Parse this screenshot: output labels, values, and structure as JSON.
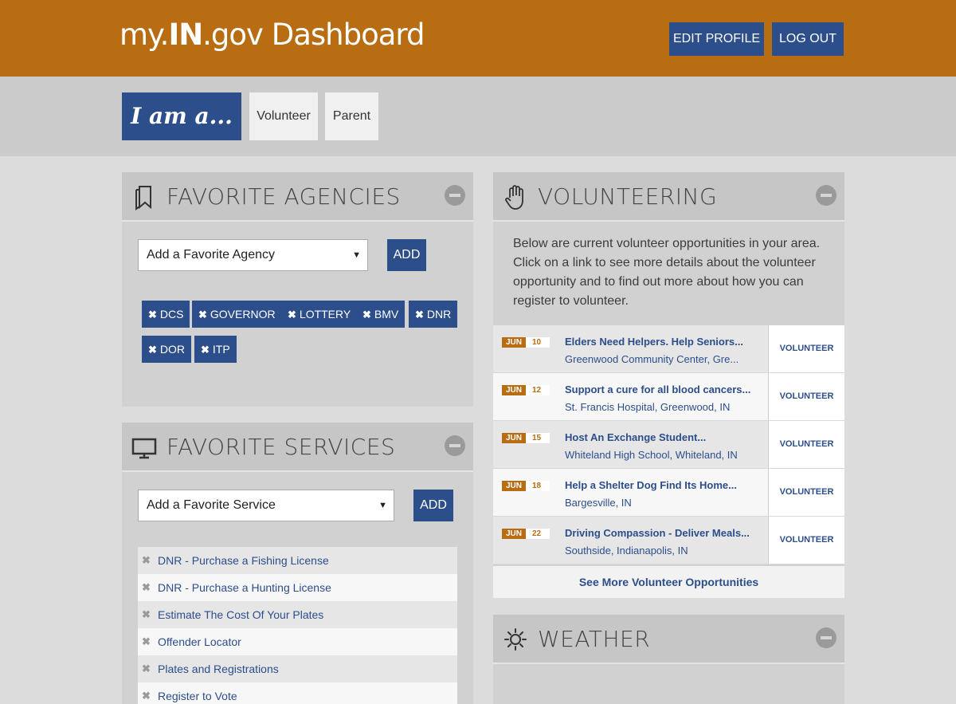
{
  "header": {
    "brand_prefix": "my.",
    "brand_bold": "IN",
    "brand_suffix": ".gov Dashboard",
    "edit_profile": "EDIT PROFILE",
    "log_out": "LOG OUT"
  },
  "roles": {
    "label": "I am a...",
    "items": [
      "Volunteer",
      "Parent"
    ]
  },
  "agencies": {
    "title": "FAVORITE AGENCIES",
    "select_value": "Add a Favorite Agency",
    "add_label": "ADD",
    "tags": [
      "DCS",
      "GOVERNOR",
      "LOTTERY",
      "BMV",
      "DNR",
      "DOR",
      "ITP"
    ]
  },
  "services": {
    "title": "FAVORITE SERVICES",
    "select_value": "Add a Favorite Service",
    "add_label": "ADD",
    "items": [
      "DNR - Purchase a Fishing License",
      "DNR - Purchase a Hunting License",
      "Estimate The Cost Of Your Plates",
      "Offender Locator",
      "Plates and Registrations",
      "Register to Vote"
    ]
  },
  "volunteering": {
    "title": "VOLUNTEERING",
    "intro": "Below are current volunteer opportunities in your area. Click on a link to see more details about the volunteer opportunity and to find out more about how you can register to volunteer.",
    "button_label": "VOLUNTEER",
    "events": [
      {
        "month": "JUN",
        "day": "10",
        "title": "Elders Need Helpers.  Help Seniors...",
        "location": "Greenwood Community Center, Gre..."
      },
      {
        "month": "JUN",
        "day": "12",
        "title": "Support a cure for all blood cancers...",
        "location": "St. Francis Hospital, Greenwood, IN"
      },
      {
        "month": "JUN",
        "day": "15",
        "title": "Host An Exchange Student...",
        "location": "Whiteland High School, Whiteland, IN"
      },
      {
        "month": "JUN",
        "day": "18",
        "title": "Help a Shelter Dog Find Its Home...",
        "location": "Bargesville, IN"
      },
      {
        "month": "JUN",
        "day": "22",
        "title": "Driving Compassion - Deliver Meals...",
        "location": "Southside, Indianapolis, IN"
      }
    ],
    "see_more": "See More Volunteer Opportunities"
  },
  "weather": {
    "title": "WEATHER"
  },
  "colors": {
    "header_bg": "#b86d13",
    "accent_blue": "#2c4e8a",
    "panel_bg": "#d1d1d1"
  },
  "icons": {
    "agencies": "bookmark-icon",
    "services": "monitor-icon",
    "volunteering": "raised-hand-icon",
    "weather": "sun-icon",
    "collapse": "minus-circle-icon",
    "remove": "x-icon",
    "dropdown": "caret-down-icon"
  }
}
